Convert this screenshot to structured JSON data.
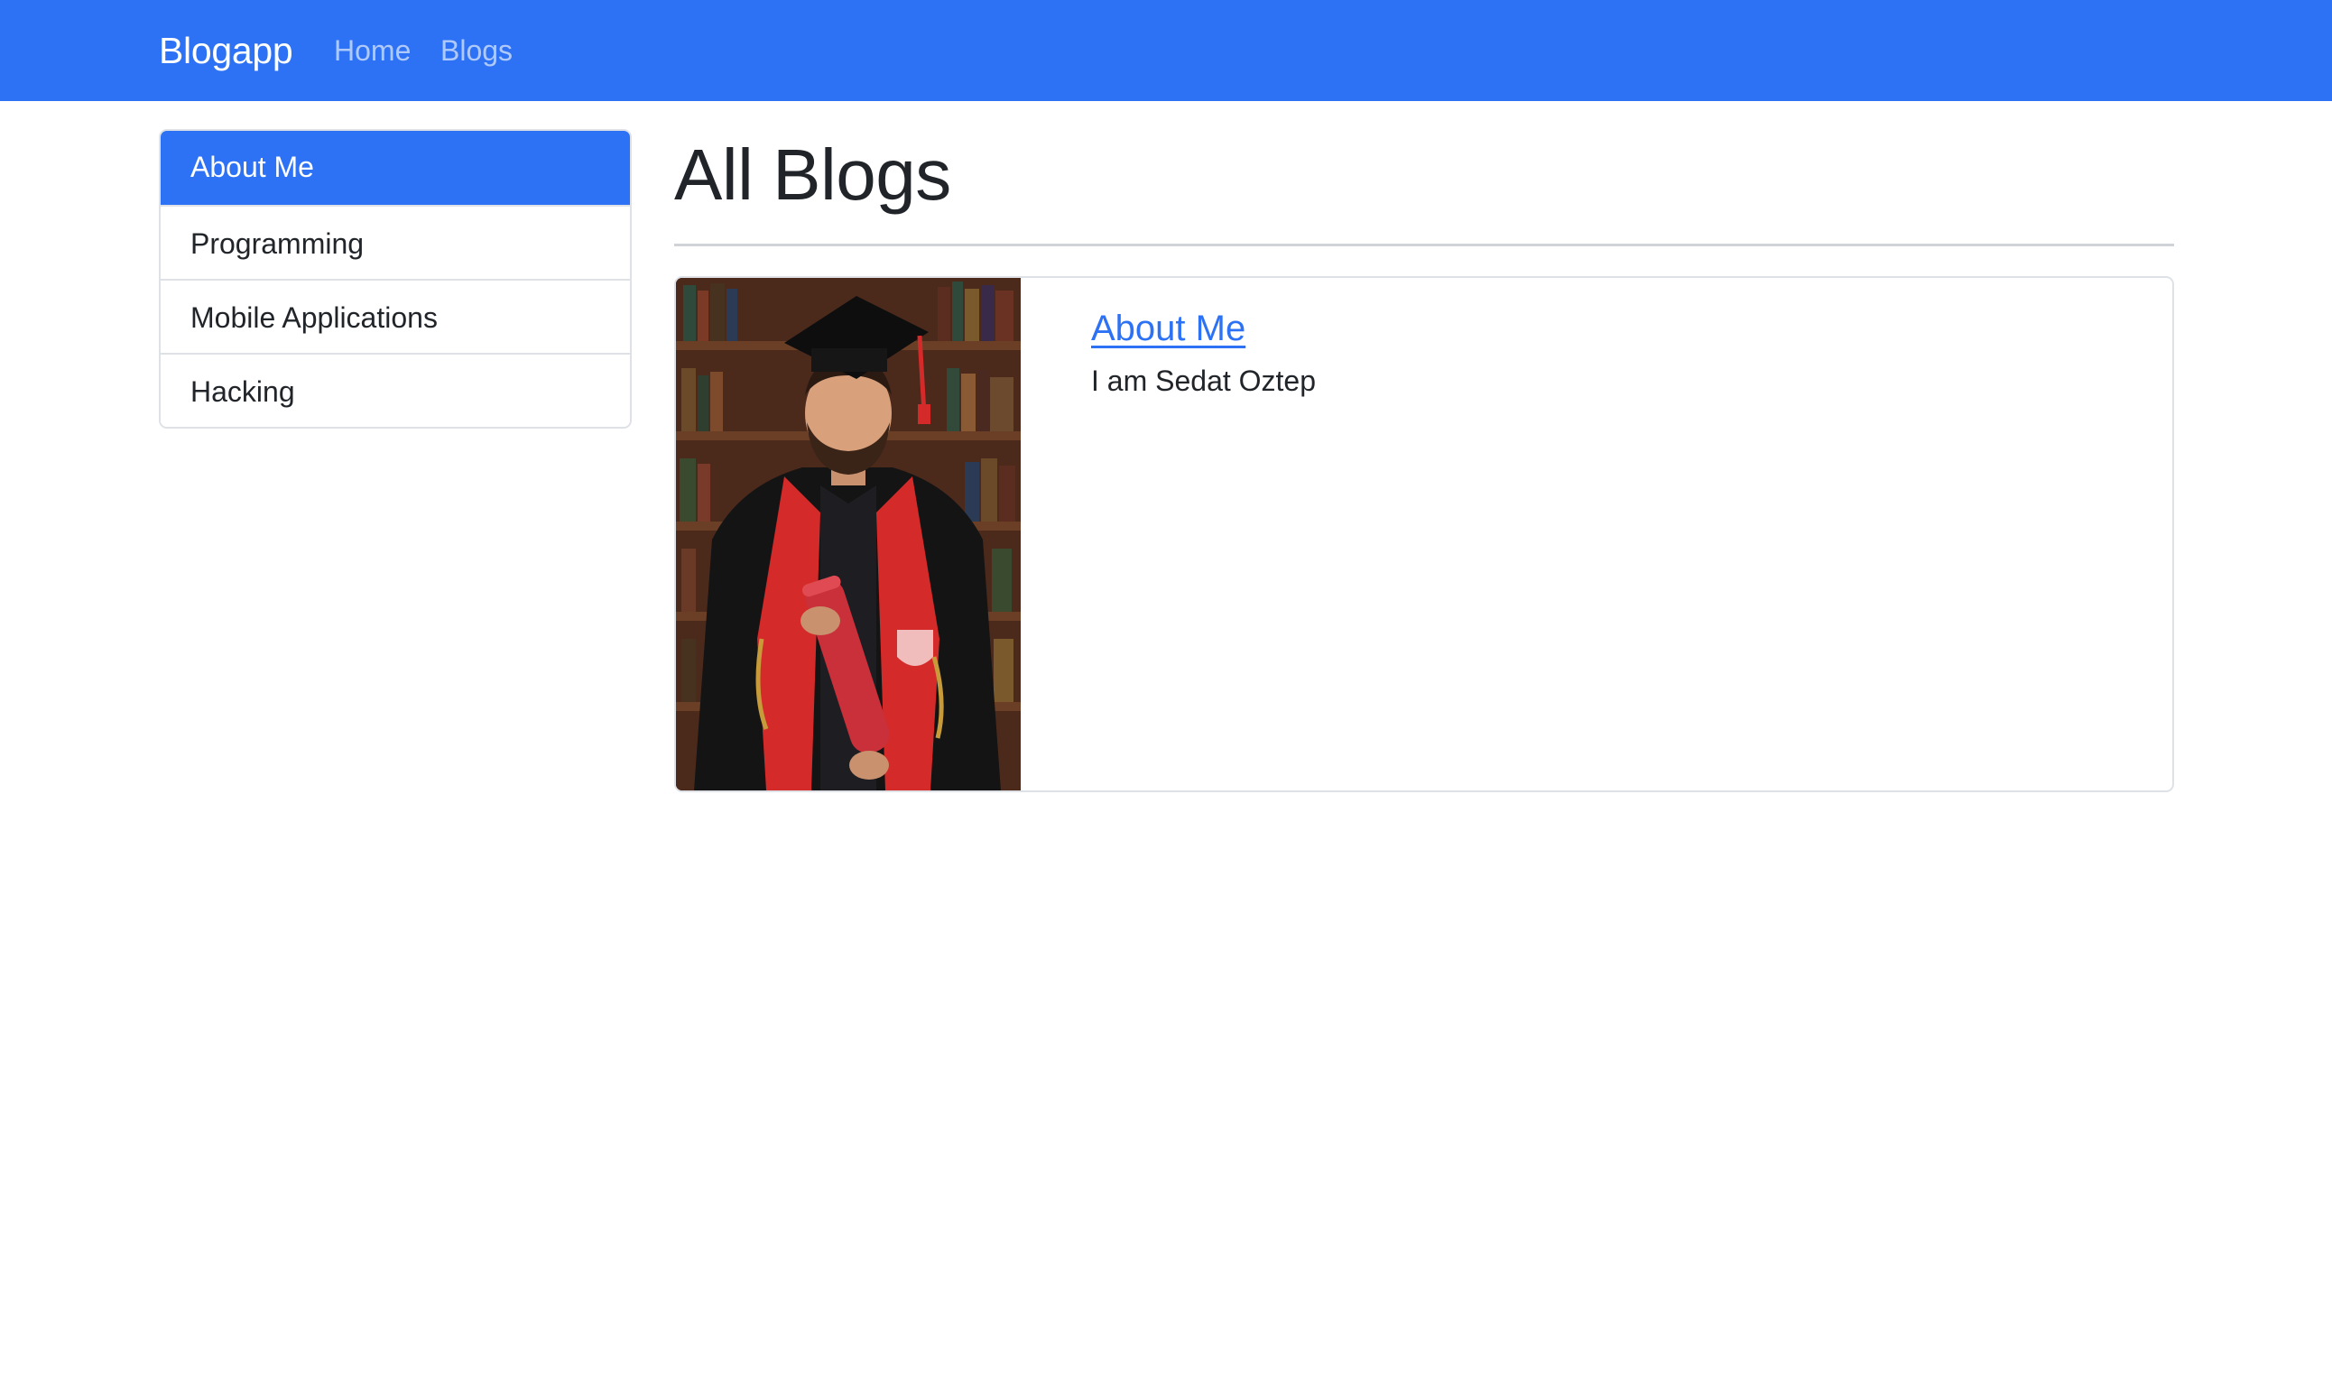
{
  "navbar": {
    "brand": "Blogapp",
    "links": [
      "Home",
      "Blogs"
    ]
  },
  "sidebar": {
    "items": [
      {
        "label": "About Me",
        "active": true
      },
      {
        "label": "Programming",
        "active": false
      },
      {
        "label": "Mobile Applications",
        "active": false
      },
      {
        "label": "Hacking",
        "active": false
      }
    ]
  },
  "main": {
    "title": "All Blogs",
    "blogs": [
      {
        "title": "About Me",
        "description": "I am Sedat Oztep",
        "image": "graduation-portrait"
      }
    ]
  },
  "colors": {
    "primary": "#2d72f4",
    "text": "#212529",
    "border": "#dee2e6"
  }
}
